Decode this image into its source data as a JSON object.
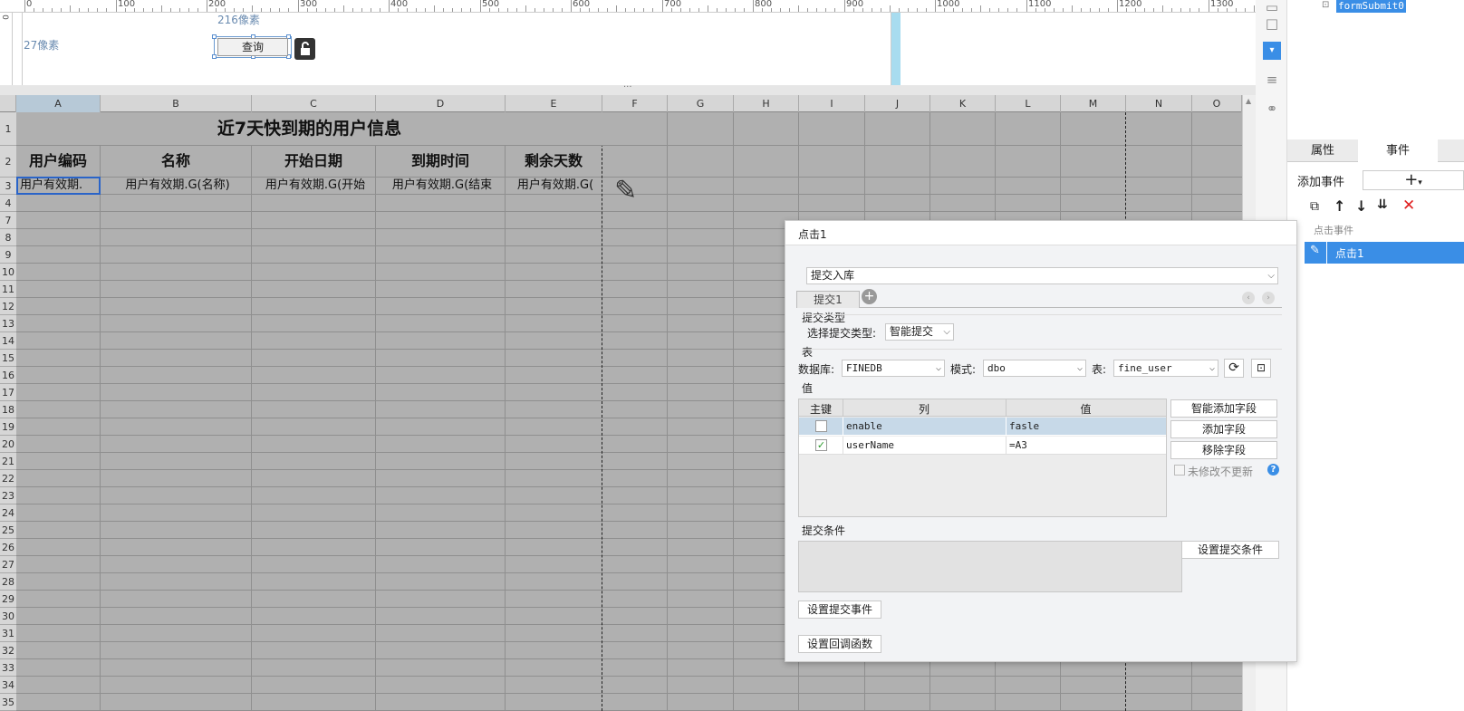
{
  "ruler": {
    "labels": [
      "0",
      "100",
      "200",
      "300",
      "400",
      "500",
      "600",
      "700",
      "800",
      "900",
      "1000",
      "1100",
      "1200",
      "1300"
    ]
  },
  "form": {
    "width_label": "216像素",
    "height_label": "27像素",
    "query_button": "查询"
  },
  "grid": {
    "columns": [
      "A",
      "B",
      "C",
      "D",
      "E",
      "F",
      "G",
      "H",
      "I",
      "J",
      "K",
      "L",
      "M",
      "N",
      "O"
    ],
    "rows": [
      "1",
      "2",
      "3",
      "4",
      "7",
      "8",
      "9",
      "10",
      "11",
      "12",
      "13",
      "14",
      "15",
      "16",
      "17",
      "18",
      "19",
      "20",
      "21",
      "22",
      "23",
      "24",
      "25",
      "26",
      "27",
      "28",
      "29",
      "30",
      "31",
      "32",
      "33",
      "34",
      "35"
    ],
    "title": "近7天快到期的用户信息",
    "headers": [
      "用户编码",
      "名称",
      "开始日期",
      "到期时间",
      "剩余天数"
    ],
    "row3": [
      "用户有效期.",
      "用户有效期.G(名称)",
      "用户有效期.G(开始",
      "用户有效期.G(结束",
      "用户有效期.G("
    ]
  },
  "right_panel": {
    "tree_item": "formSubmit0",
    "tabs": [
      "属性",
      "事件"
    ],
    "add_event_label": "添加事件",
    "add_symbol": "+",
    "event_group": "点击事件",
    "event_item": "点击1"
  },
  "dialog": {
    "title": "点击1",
    "action_select": "提交入库",
    "tab_label": "提交1",
    "submit_type_section": "提交类型",
    "submit_type_label": "选择提交类型:",
    "submit_type_value": "智能提交",
    "table_section": "表",
    "db_label": "数据库:",
    "db_value": "FINEDB",
    "schema_label": "模式:",
    "schema_value": "dbo",
    "table_label": "表:",
    "table_value": "fine_user",
    "value_section": "值",
    "col_headers": [
      "主键",
      "列",
      "值"
    ],
    "rows": [
      {
        "pk": false,
        "column": "enable",
        "value": "fasle"
      },
      {
        "pk": true,
        "column": "userName",
        "value": "=A3"
      }
    ],
    "smart_add_field": "智能添加字段",
    "add_field": "添加字段",
    "remove_field": "移除字段",
    "no_update_unmodified": "未修改不更新",
    "help_icon_char": "?",
    "condition_section": "提交条件",
    "set_condition": "设置提交条件",
    "set_submit_event": "设置提交事件",
    "set_callback": "设置回调函数"
  },
  "colors": {
    "accent": "#3a8ee6",
    "grid_bg": "#b0b0b0",
    "cyan": "#a8dcef",
    "delete_red": "#e02020"
  }
}
